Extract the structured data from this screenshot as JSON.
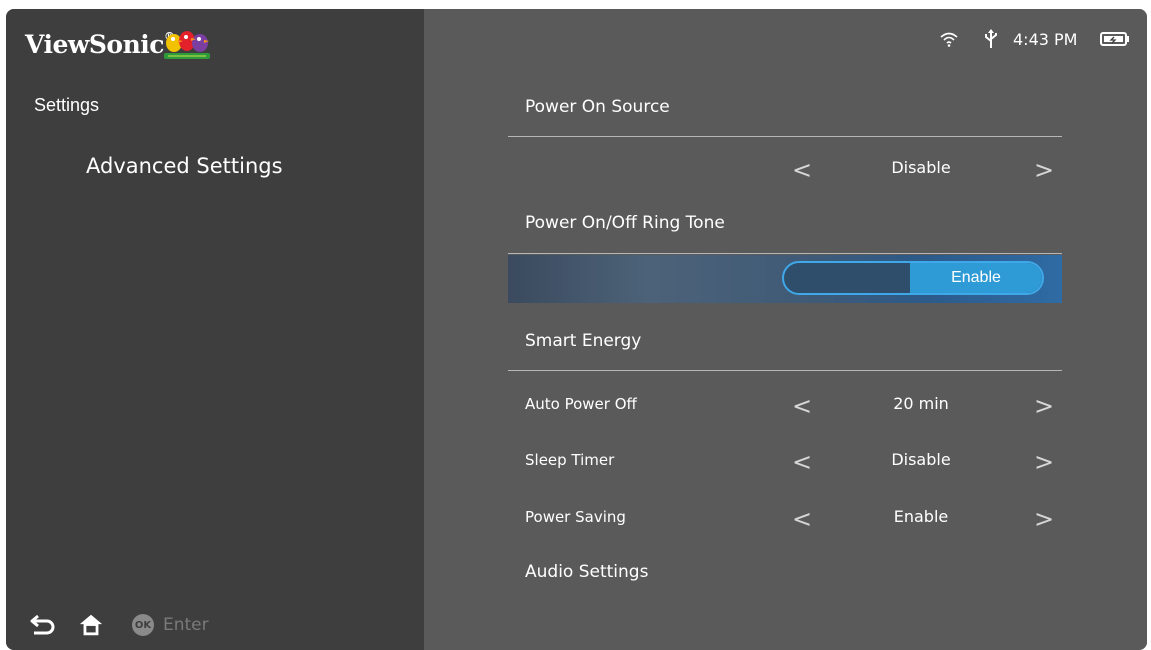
{
  "brand": {
    "name": "ViewSonic",
    "mark": "®"
  },
  "left_panel": {
    "section_title": "Settings",
    "subsection": "Advanced Settings"
  },
  "bottom_nav": {
    "back_icon": "back-icon",
    "home_icon": "home-icon",
    "ok_badge": "OK",
    "enter_label": "Enter"
  },
  "status_bar": {
    "wifi_icon": "wifi-icon",
    "usb_icon": "usb-icon",
    "time": "4:43 PM",
    "battery_icon": "battery-icon"
  },
  "settings": {
    "power_on_source": {
      "label": "Power On Source",
      "value": "Disable"
    },
    "ring_tone": {
      "label": "Power On/Off Ring Tone",
      "value": "Enable"
    },
    "smart_energy": {
      "label": "Smart Energy"
    },
    "auto_power_off": {
      "label": "Auto Power Off",
      "value": "20 min"
    },
    "sleep_timer": {
      "label": "Sleep Timer",
      "value": "Disable"
    },
    "power_saving": {
      "label": "Power Saving",
      "value": "Enable"
    },
    "audio": {
      "label": "Audio Settings"
    }
  },
  "colors": {
    "left_bg": "#3e3e3f",
    "right_bg": "#5a5a5a",
    "accent": "#2e9ad6"
  }
}
